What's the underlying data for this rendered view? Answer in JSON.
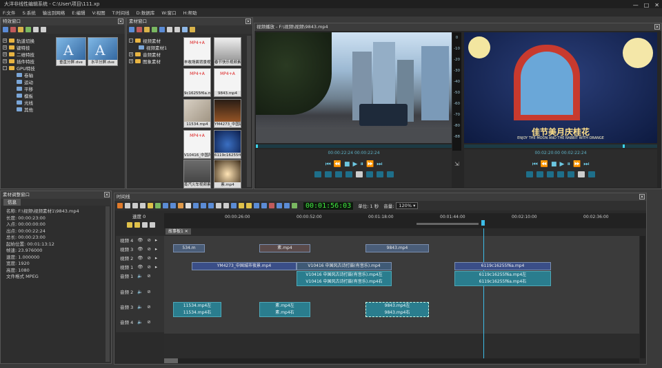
{
  "app": {
    "title": "大洋非线性编辑系统 - C:\\User\\项目\\111.xp",
    "controls": [
      "—",
      "□",
      "✕"
    ]
  },
  "menu": [
    "F:文件",
    "S:系统",
    "输出到网络",
    "E:编辑",
    "V:视图",
    "T:时间线",
    "D:数据库",
    "W:窗口",
    "H:帮助"
  ],
  "effects_panel": {
    "title": "特效窗口",
    "tree": [
      {
        "label": "轨道切换",
        "type": "folder",
        "exp": "+"
      },
      {
        "label": "键特技",
        "type": "folder",
        "exp": "+"
      },
      {
        "label": "二维特技",
        "type": "folder",
        "exp": "+"
      },
      {
        "label": "插件特技",
        "type": "folder",
        "exp": "+"
      },
      {
        "label": "GPU特技",
        "type": "folder",
        "exp": "-"
      },
      {
        "label": "卷轴",
        "type": "sub"
      },
      {
        "label": "运动",
        "type": "sub"
      },
      {
        "label": "平移",
        "type": "sub"
      },
      {
        "label": "模板",
        "type": "sub"
      },
      {
        "label": "光线",
        "type": "sub"
      },
      {
        "label": "其他",
        "type": "sub"
      }
    ],
    "thumbs": [
      {
        "caption": "垂直分屏.dve"
      },
      {
        "caption": "水平分屏.dve"
      }
    ]
  },
  "material_panel": {
    "title": "素材窗口",
    "tree": [
      {
        "label": "视频素材",
        "type": "folder",
        "exp": "-"
      },
      {
        "label": "视频素材1",
        "type": "sub"
      },
      {
        "label": "音频素材",
        "type": "folder",
        "exp": "+"
      },
      {
        "label": "图象素材",
        "type": "folder",
        "exp": "+"
      }
    ],
    "thumbs": [
      {
        "caption": "丰收场面背景视频",
        "tag": "MP4+A"
      },
      {
        "caption": "春节快乐视频素材",
        "tag": ""
      },
      {
        "caption": "9c16255f6a.mp4",
        "tag": "MP4+A"
      },
      {
        "caption": "9843.mp4",
        "tag": "MP4+A"
      },
      {
        "caption": "11534.mp4",
        "tag": ""
      },
      {
        "caption": "YM4273_中国城市夜景",
        "tag": "MP4+A"
      },
      {
        "caption": "V10416_中国风...",
        "tag": "MP4+A"
      },
      {
        "caption": "6119c16255f6a",
        "tag": "MP4+A"
      },
      {
        "caption": "蒸汽火车视频素材",
        "tag": ""
      },
      {
        "caption": "素.mp4",
        "tag": "MP4+A"
      }
    ]
  },
  "preview": {
    "title": "视频播放 - F:\\视频\\视频\\9843.mp4",
    "left_timecode": "00:00:22:24  00:00:22:24",
    "right_timecode": "00:02:20:00  00:02:22:24",
    "ruler": [
      "0",
      "-10",
      "-20",
      "-30",
      "-40",
      "-50",
      "-60",
      "-70",
      "-80",
      "-88"
    ],
    "overlay_text": "佳节美月庆桂花",
    "overlay_sub": "ENJOY THE MOON AND THE RABBIT WITH ORANGE"
  },
  "props_panel": {
    "title": "素材调整窗口",
    "tab": "信息",
    "rows": [
      "名称:  F:\\视频\\视频素材1\\9843.mp4",
      "长度:  00:00:23:00",
      "入点:  00:00:00:00",
      "出点:  00:00:22:24",
      "总长:  00:00:23:00",
      "起始位置:  00:01:13:12",
      "帧速:  23.976000",
      "速度:  1.000000",
      "宽度:  1920",
      "高度:  1080",
      "文件格式  MPEG"
    ]
  },
  "timeline": {
    "title": "时间线",
    "timecode": "00:01:56:03",
    "unit_label": "单位: 1 秒",
    "scale_label": "音量:",
    "zoom": "120%",
    "speed_label": "速度 0",
    "ruler": [
      "00:00:26:00",
      "00:00:52:00",
      "00:01:18:00",
      "00:01:44:00",
      "00:02:10:00",
      "00:02:36:00"
    ],
    "tab": "故事板1",
    "tracks": [
      {
        "name": "视频 4"
      },
      {
        "name": "视频 3"
      },
      {
        "name": "视频 2"
      },
      {
        "name": "视频 1"
      },
      {
        "name": "音频 1"
      },
      {
        "name": "音频 2"
      },
      {
        "name": "音频 3"
      },
      {
        "name": "音频 4"
      }
    ],
    "clips": {
      "v3a": "534.m",
      "v3b": "素.mp4",
      "v3c": "9843.mp4",
      "v1a": "YM4273_中国城市夜景.mp4",
      "v1b": "V10416 中国风古诗打鼓(有音乐).mp4",
      "v1c": "6119c16255f6a.mp4",
      "a1a_l": "V10416 中国风古诗打鼓(有音乐).mp4左",
      "a1a_r": "V10416 中国风古诗打鼓(有音乐).mp4右",
      "a1b_l": "6119c16255f6a.mp4左",
      "a1b_r": "6119c16255f6a.mp4右",
      "a3a_l": "11534.mp4左",
      "a3a_r": "11534.mp4右",
      "a3b_l": "素.mp4左",
      "a3b_r": "素.mp4右",
      "a3c_l": "9843.mp4左",
      "a3c_r": "9843.mp4右"
    }
  }
}
